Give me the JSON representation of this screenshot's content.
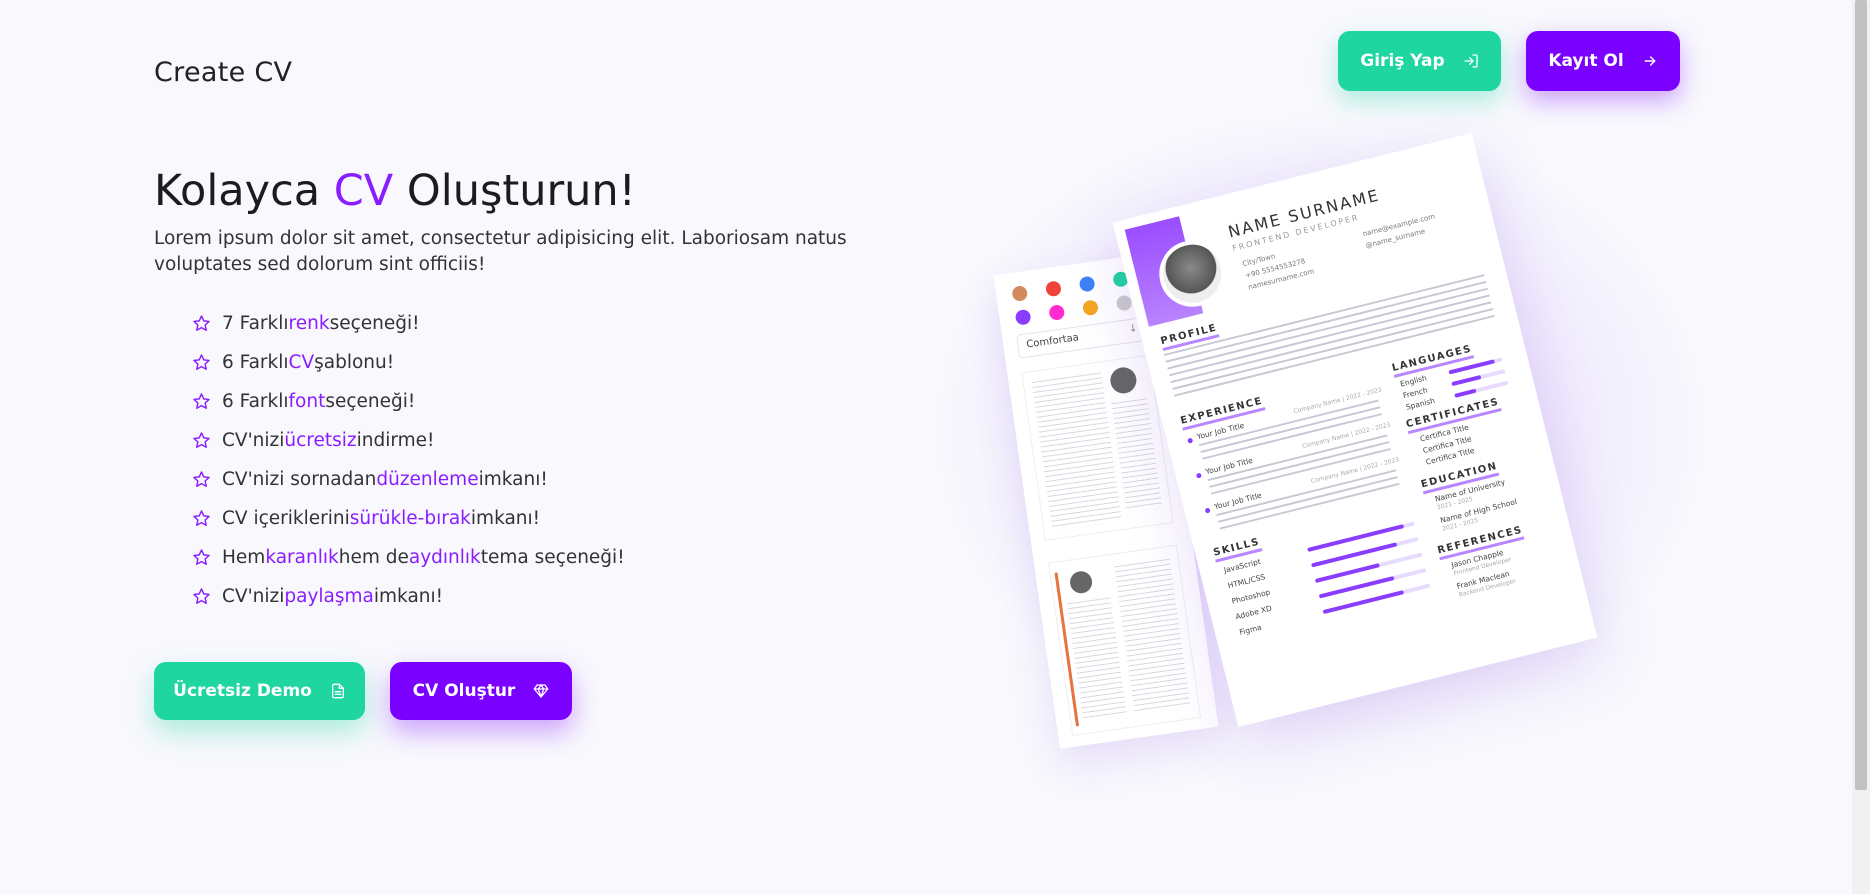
{
  "header": {
    "logo": "Create CV",
    "login_label": "Giriş Yap",
    "register_label": "Kayıt Ol"
  },
  "hero": {
    "title_before": "Kolayca ",
    "title_accent": "CV",
    "title_after": " Oluşturun!",
    "description": "Lorem ipsum dolor sit amet, consectetur adipisicing elit. Laboriosam natus voluptates sed dolorum sint officiis!",
    "features": [
      {
        "pre": "7 Farklı ",
        "hl": "renk",
        "post": " seçeneği!"
      },
      {
        "pre": "6 Farklı ",
        "hl": "CV",
        "post": " şablonu!"
      },
      {
        "pre": "6 Farklı ",
        "hl": "font",
        "post": " seçeneği!"
      },
      {
        "pre": "CV'nizi ",
        "hl": "ücretsiz",
        "post": " indirme!"
      },
      {
        "pre": "CV'nizi sornadan ",
        "hl": "düzenleme",
        "post": " imkanı!"
      },
      {
        "pre": "CV içeriklerini ",
        "hl": "sürükle-bırak",
        "post": " imkanı!"
      },
      {
        "pre": "Hem ",
        "hl": "karanlık",
        "mid": " hem de ",
        "hl2": "aydınlık",
        "post": " tema seçeneği!"
      },
      {
        "pre": "CV'nizi ",
        "hl": "paylaşma",
        "post": " imkanı!"
      }
    ],
    "demo_label": "Ücretsiz Demo",
    "create_label": "CV Oluştur"
  },
  "cv_preview": {
    "name": "NAME SURNAME",
    "role": "FRONTEND DEVELOPER",
    "contacts": [
      "City/Town",
      "+90 5554553278",
      "namesurname.com",
      "name@example.com",
      "@name_surname"
    ],
    "sections": {
      "profile": "PROFILE",
      "experience": "EXPERIENCE",
      "skills": "SKILLS",
      "languages": "LANGUAGES",
      "certificates": "CERTIFICATES",
      "education": "EDUCATION",
      "references": "REFERENCES"
    },
    "jobs": [
      {
        "title": "Your Job Title",
        "company": "Company Name | 2022 - 2023"
      },
      {
        "title": "Your Job Title",
        "company": "Company Name | 2022 - 2023"
      },
      {
        "title": "Your Job Title",
        "company": "Company Name | 2022 - 2023"
      }
    ],
    "skills": [
      {
        "name": "JavaScript",
        "level": 0.9
      },
      {
        "name": "HTML/CSS",
        "level": 0.8
      },
      {
        "name": "Photoshop",
        "level": 0.6
      },
      {
        "name": "Adobe XD",
        "level": 0.7
      },
      {
        "name": "Figma",
        "level": 0.75
      }
    ],
    "languages": [
      {
        "name": "English",
        "level": 0.85
      },
      {
        "name": "French",
        "level": 0.55
      },
      {
        "name": "Spanish",
        "level": 0.4
      }
    ],
    "certificates": [
      "Certifica Title",
      "Certifica Title",
      "Certifica Title"
    ],
    "education": [
      {
        "name": "Name of University",
        "years": "2021 - 2025"
      },
      {
        "name": "Name of High School",
        "years": "2021 - 2025"
      }
    ],
    "references": [
      {
        "name": "Jason Chapple",
        "role": "Frontend Developer"
      },
      {
        "name": "Frank Maclean",
        "role": "Backend Developer"
      }
    ],
    "font_option": "Comfortaa",
    "swatches": [
      "#d38b5d",
      "#f0433a",
      "#3b82f6",
      "#1fd6a0",
      "#8a3dff",
      "#ff2bd1",
      "#f5a623",
      "#cccccc"
    ]
  },
  "colors": {
    "accent": "#8a1dff",
    "primary_button": "#7a00ff",
    "secondary_button": "#1fd6a0"
  }
}
